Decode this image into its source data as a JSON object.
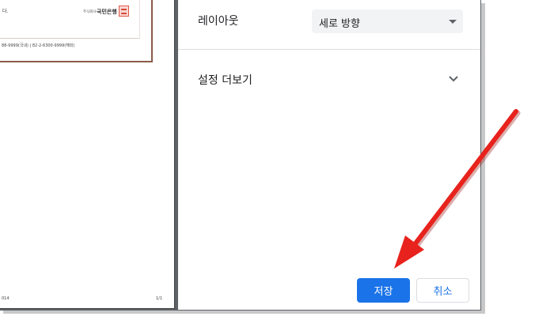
{
  "preview": {
    "doc_text_top": "다.",
    "bank_company_small": "주식회사",
    "bank_name": "국민은행",
    "phone_line": "88-9999(국내) | 82-2-6300-9999(해외)",
    "footer_left": "014",
    "footer_right": "1/1"
  },
  "settings": {
    "layout_label": "레이아웃",
    "layout_value": "세로 방향",
    "more_settings_label": "설정 더보기"
  },
  "buttons": {
    "save_label": "저장",
    "cancel_label": "취소"
  },
  "colors": {
    "primary": "#1a73e8",
    "arrow": "#e8221c",
    "preview_background": "#5f6368"
  },
  "icons": {
    "select_caret": "caret-down-icon",
    "more_settings": "chevron-down-icon",
    "seal": "bank-seal-icon",
    "annotation": "red-arrow-icon"
  }
}
